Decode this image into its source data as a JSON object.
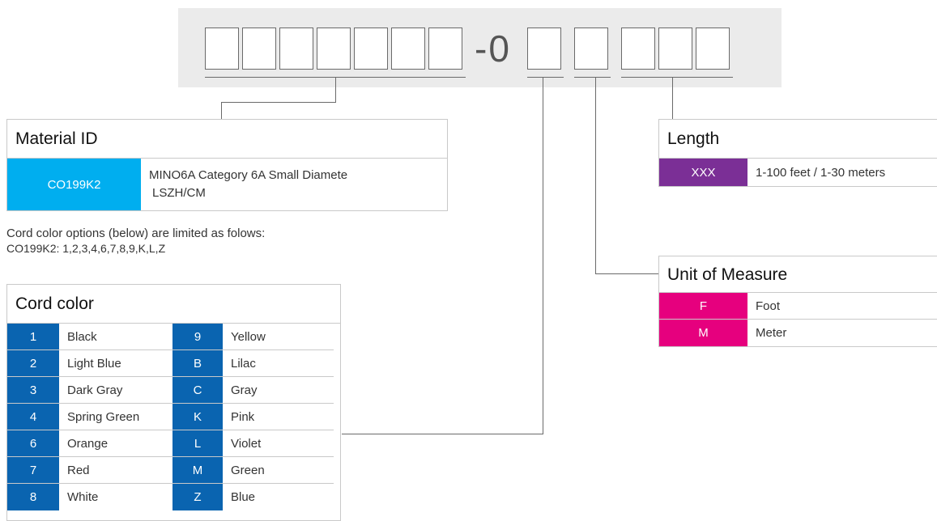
{
  "part_number": {
    "separator": "-0",
    "groups": [
      {
        "name": "material-id",
        "count": 7
      },
      {
        "name": "cord-color",
        "count": 1
      },
      {
        "name": "unit-of-measure",
        "count": 1
      },
      {
        "name": "length",
        "count": 3
      }
    ]
  },
  "material_id": {
    "title": "Material ID",
    "rows": [
      {
        "code": "CO199K2",
        "description_line1": "MINO6A Category 6A Small Diamete",
        "description_line2": "LSZH/CM"
      }
    ],
    "code_color": "#00aeef"
  },
  "note": {
    "line1": "Cord color options (below) are limited as folows:",
    "line2": "CO199K2: 1,2,3,4,6,7,8,9,K,L,Z"
  },
  "cord_color": {
    "title": "Cord color",
    "code_color": "#0a64b0",
    "rows": [
      {
        "code1": "1",
        "label1": "Black",
        "code2": "9",
        "label2": "Yellow"
      },
      {
        "code1": "2",
        "label1": "Light Blue",
        "code2": "B",
        "label2": "Lilac"
      },
      {
        "code1": "3",
        "label1": "Dark Gray",
        "code2": "C",
        "label2": "Gray"
      },
      {
        "code1": "4",
        "label1": "Spring Green",
        "code2": "K",
        "label2": "Pink"
      },
      {
        "code1": "6",
        "label1": "Orange",
        "code2": "L",
        "label2": "Violet"
      },
      {
        "code1": "7",
        "label1": "Red",
        "code2": "M",
        "label2": "Green"
      },
      {
        "code1": "8",
        "label1": "White",
        "code2": "Z",
        "label2": "Blue"
      }
    ]
  },
  "length": {
    "title": "Length",
    "code_color": "#7b2f96",
    "rows": [
      {
        "code": "XXX",
        "description": "1-100 feet / 1-30 meters"
      }
    ]
  },
  "unit_of_measure": {
    "title": "Unit of Measure",
    "code_color": "#e6007e",
    "rows": [
      {
        "code": "F",
        "description": "Foot"
      },
      {
        "code": "M",
        "description": "Meter"
      }
    ]
  }
}
